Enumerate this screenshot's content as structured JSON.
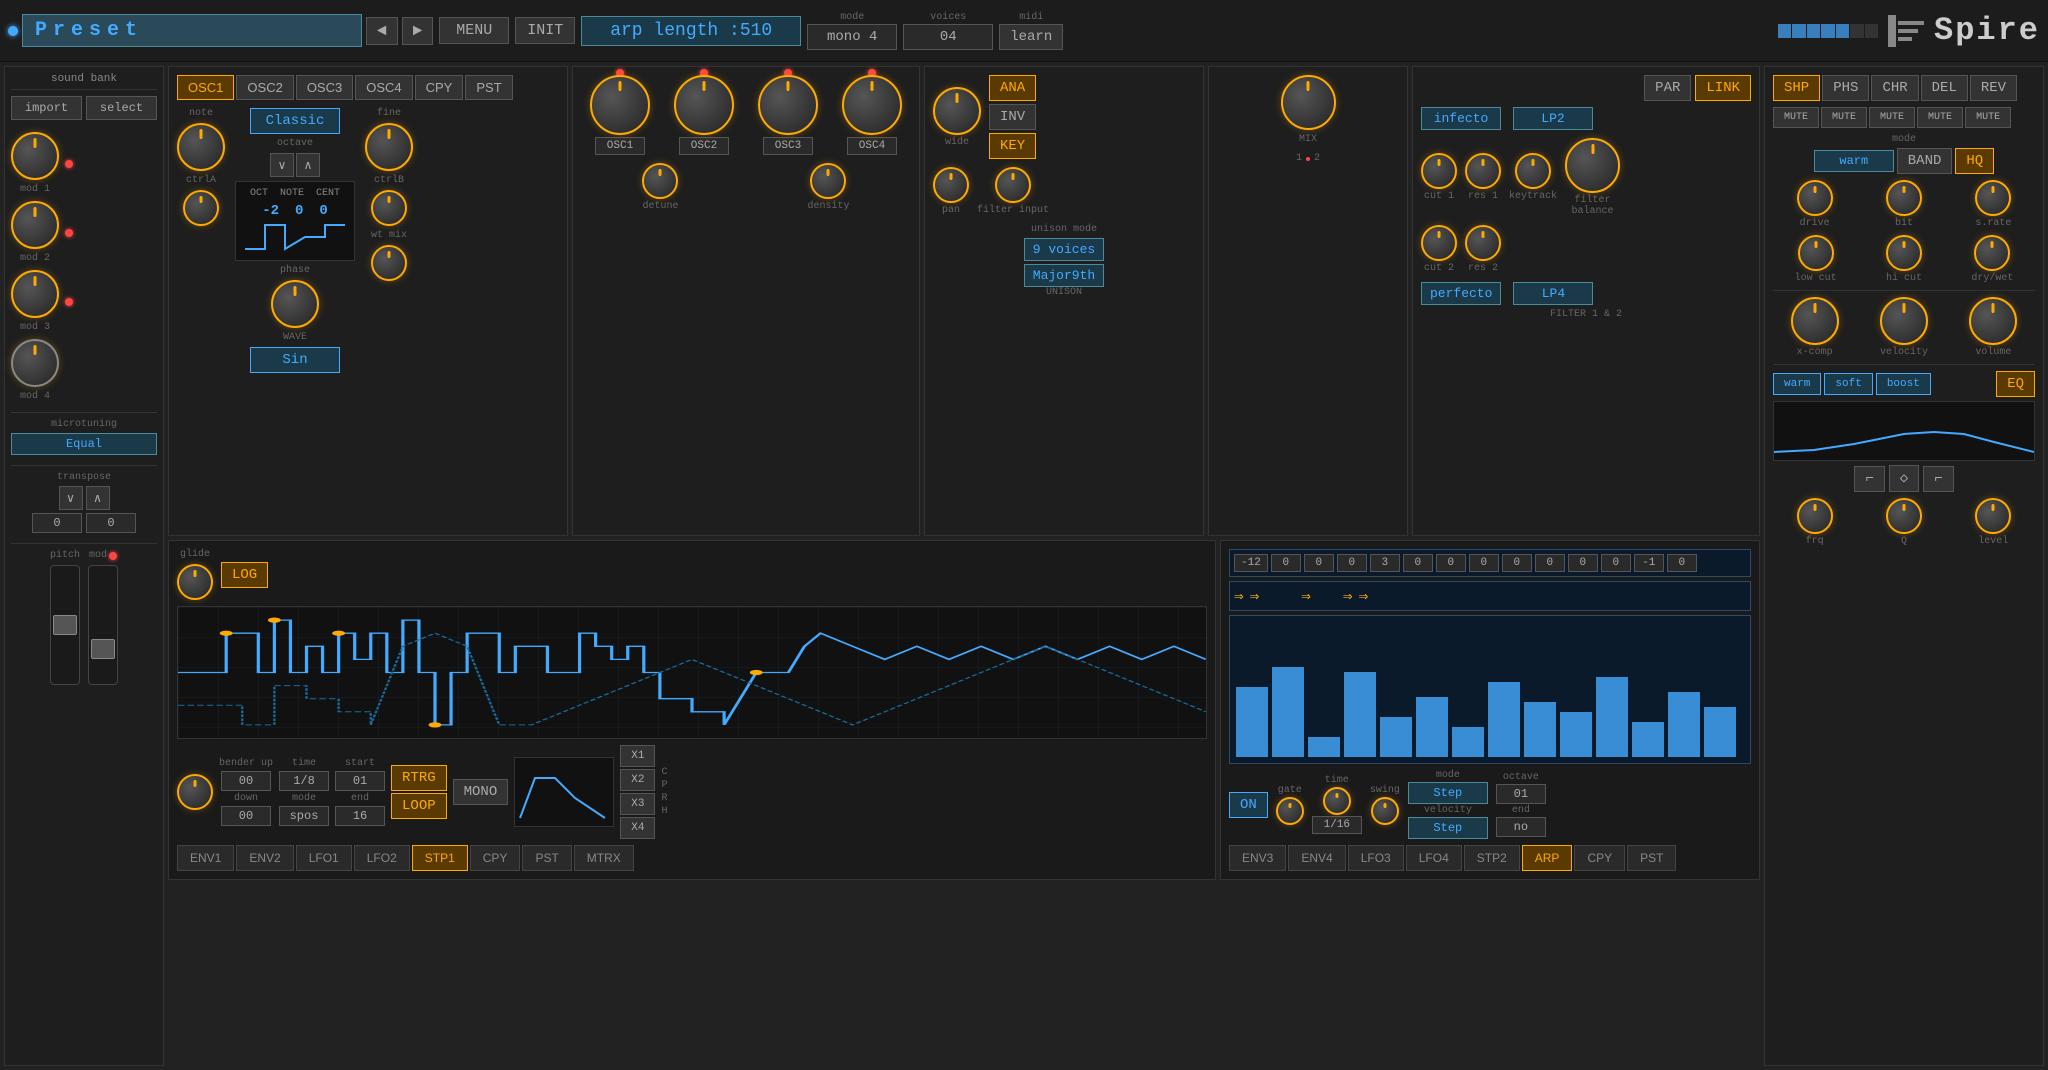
{
  "header": {
    "preset_led_color": "#4af",
    "preset_label": "Preset",
    "nav_left": "◄",
    "nav_right": "►",
    "menu_btn": "MENU",
    "init_btn": "INIT",
    "arp_display": "arp length :510",
    "mode_label": "mode",
    "mode_value": "mono 4",
    "voices_label": "voices",
    "voices_value": "04",
    "midi_label": "midi",
    "midi_value": "learn",
    "logo": "Spire"
  },
  "sidebar": {
    "title": "sound bank",
    "import_btn": "import",
    "select_btn": "select",
    "mod1_label": "mod 1",
    "mod2_label": "mod 2",
    "mod3_label": "mod 3",
    "mod4_label": "mod 4",
    "microtuning_label": "microtuning",
    "microtuning_value": "Equal",
    "transpose_label": "transpose",
    "transpose_down": "∨",
    "transpose_up": "∧",
    "transpose_val1": "0",
    "transpose_val2": "0",
    "pitch_label": "pitch",
    "mod_label": "mod"
  },
  "osc": {
    "tabs": [
      "OSC1",
      "OSC2",
      "OSC3",
      "OSC4",
      "CPY",
      "PST"
    ],
    "active_tab": "OSC1",
    "note_label": "note",
    "classic_btn": "Classic",
    "octave_label": "octave",
    "oct_down": "∨",
    "oct_up": "∧",
    "fine_label": "fine",
    "ctrla_label": "ctrlA",
    "ctrlb_label": "ctrlB",
    "oct_val": "-2",
    "note_val": "0",
    "cent_val": "0",
    "oct_label": "OCT",
    "note_label2": "NOTE",
    "cent_label": "CENT",
    "phase_label": "phase",
    "wave_label": "WAVE",
    "wave_value": "Sin",
    "wtmix_label": "wt mix"
  },
  "osc_mid": {
    "osc1_label": "OSC1",
    "osc2_label": "OSC2",
    "osc3_label": "OSC3",
    "osc4_label": "OSC4",
    "detune_label": "detune",
    "density_label": "density"
  },
  "unison": {
    "title": "UNISON",
    "wide_label": "wide",
    "ana_btn": "ANA",
    "inv_btn": "INV",
    "key_btn": "KEY",
    "pan_label": "pan",
    "filter_input_label": "filter input",
    "mode_label": "unison mode",
    "mode_value": "9 voices",
    "chord_value": "Major9th"
  },
  "mix": {
    "title": "MIX",
    "mix_label1": "1",
    "mix_label2": "2"
  },
  "filter": {
    "title": "FILTER 1 & 2",
    "par_btn": "PAR",
    "link_btn": "LINK",
    "filter1_name": "infecto",
    "filter1_type": "LP2",
    "filter2_name": "perfecto",
    "filter2_type": "LP4",
    "cut1_label": "cut 1",
    "res1_label": "res 1",
    "keytrack_label": "keytrack",
    "cut2_label": "cut 2",
    "res2_label": "res 2",
    "balance_label": "filter\nbalance"
  },
  "right_panel": {
    "shp_btn": "SHP",
    "phs_btn": "PHS",
    "chr_btn": "CHR",
    "del_btn": "DEL",
    "rev_btn": "REV",
    "mute_labels": [
      "MUTE",
      "MUTE",
      "MUTE",
      "MUTE",
      "MUTE"
    ],
    "mode_label": "mode",
    "warm_btn": "warm",
    "band_btn": "BAND",
    "hq_btn": "HQ",
    "drive_label": "drive",
    "bit_label": "bit",
    "srate_label": "s.rate",
    "lowcut_label": "low cut",
    "hicut_label": "hi cut",
    "drywet_label": "dry/wet",
    "xcomp_label": "x-comp",
    "velocity_label": "velocity",
    "volume_label": "volume",
    "warm_eq_btn": "warm",
    "soft_eq_btn": "soft",
    "boost_eq_btn": "boost",
    "eq_btn": "EQ",
    "frq_label": "frq",
    "q_label": "Q",
    "level_label": "level"
  },
  "env_panel": {
    "glide_label": "glide",
    "log_btn": "LOG",
    "bender_up_label": "bender\nup",
    "bender_up_val": "00",
    "bender_down_label": "down",
    "bender_down_val": "00",
    "time_label": "time",
    "time_val": "1/8",
    "start_label": "start",
    "start_val": "01",
    "rtrg_btn": "RTRG",
    "mode_label": "mode",
    "mode_val": "spos",
    "end_label": "end",
    "end_val": "16",
    "loop_btn": "LOOP",
    "mono_btn": "MONO",
    "x1_label": "X1",
    "x2_label": "X2",
    "x3_label": "X3",
    "x4_label": "X4",
    "c_label": "C",
    "p_label": "P",
    "r_label": "R",
    "h_label": "H",
    "bottom_tabs": [
      "ENV1",
      "ENV2",
      "LFO1",
      "LFO2",
      "STP1",
      "CPY",
      "PST",
      "MTRX"
    ],
    "active_tab": "STP1"
  },
  "arp_panel": {
    "values": [
      "-12",
      "0",
      "0",
      "0",
      "3",
      "0",
      "0",
      "0",
      "0",
      "0",
      "0",
      "0",
      "-1",
      "0"
    ],
    "on_btn": "ON",
    "gate_label": "gate",
    "time_label": "time",
    "time_val": "1/16",
    "swing_label": "swing",
    "mode_label": "mode",
    "mode_value": "Step",
    "octave_label": "octave",
    "octave_val": "01",
    "velocity_label": "velocity",
    "velocity_value": "Step",
    "end_label": "end",
    "end_val": "no",
    "bottom_tabs": [
      "ENV3",
      "ENV4",
      "LFO3",
      "LFO4",
      "STP2",
      "ARP",
      "CPY",
      "PST"
    ],
    "active_tab": "ARP",
    "bars": [
      70,
      90,
      20,
      85,
      40,
      60,
      30,
      75,
      55,
      45,
      80,
      35,
      65,
      50
    ]
  }
}
